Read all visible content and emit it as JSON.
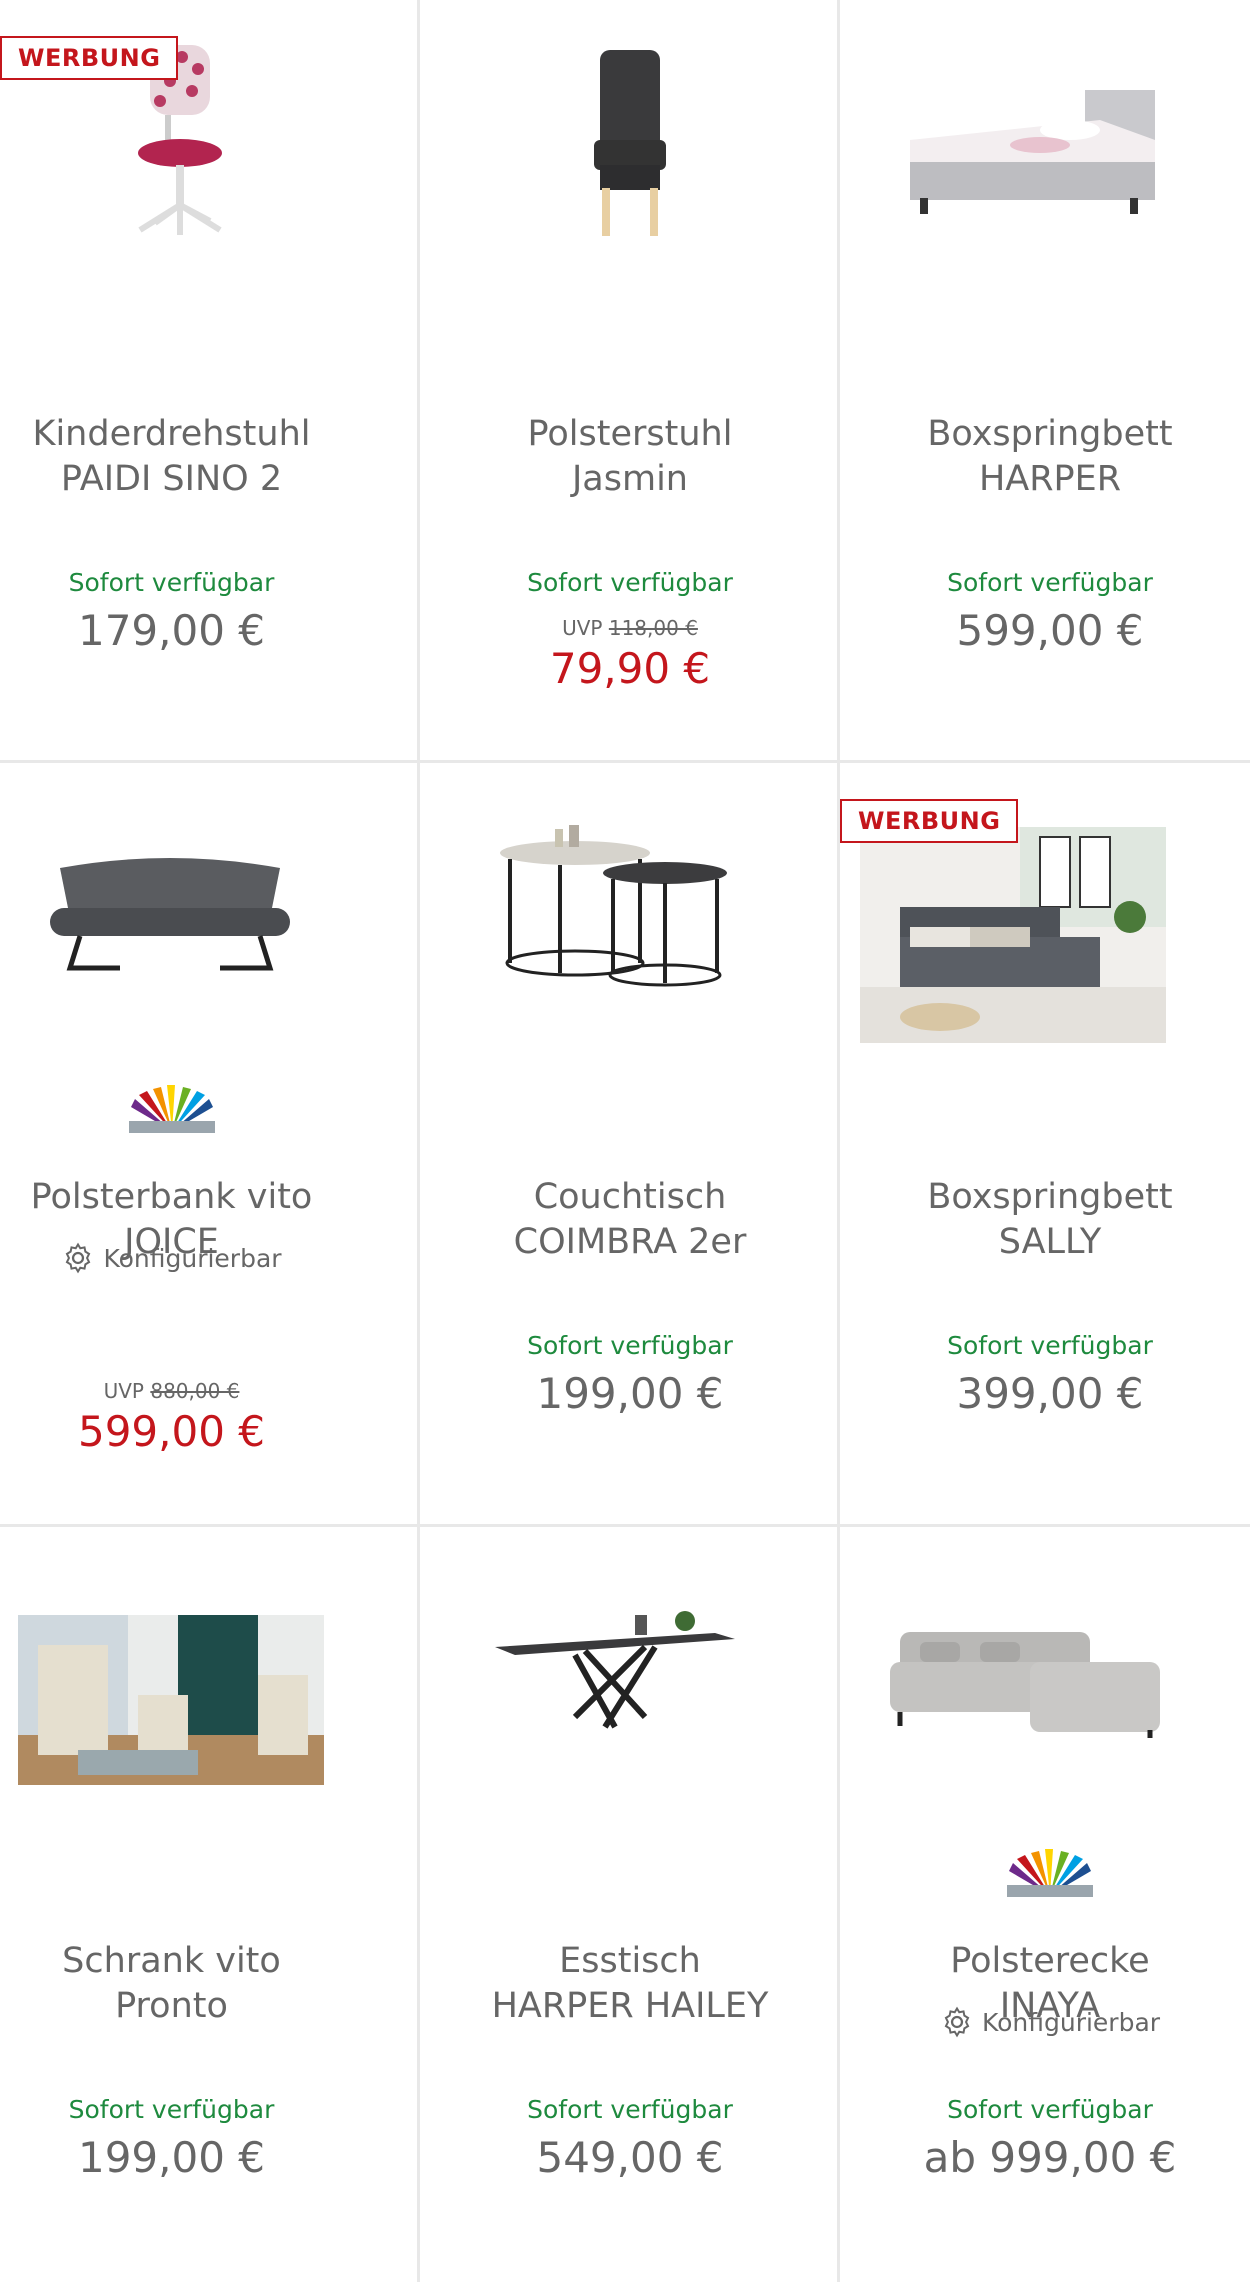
{
  "products": [
    {
      "badge": "WERBUNG",
      "title_line1": "Kinderdrehstuhl",
      "title_line2": "PAIDI SINO 2",
      "availability": "Sofort verfügbar",
      "price": "179,00 €",
      "image_icon": "child-swivel-chair-image"
    },
    {
      "title_line1": "Polsterstuhl",
      "title_line2": "Jasmin",
      "availability": "Sofort verfügbar",
      "uvp_label": "UVP",
      "uvp_price": "118,00 €",
      "price": "79,90 €",
      "image_icon": "upholstered-chair-image"
    },
    {
      "title_line1": "Boxspringbett",
      "title_line2": "HARPER",
      "availability": "Sofort verfügbar",
      "price": "599,00 €",
      "image_icon": "boxspring-bed-image"
    },
    {
      "title_line1": "Polsterbank vito",
      "title_line2": "JOICE",
      "configurable": "Konfigurierbar",
      "uvp_label": "UVP",
      "uvp_price": "880,00 €",
      "price": "599,00 €",
      "image_icon": "upholstered-bench-image",
      "has_palette": true
    },
    {
      "title_line1": "Couchtisch",
      "title_line2": "COIMBRA 2er",
      "availability": "Sofort verfügbar",
      "price": "199,00 €",
      "image_icon": "coffee-table-set-image"
    },
    {
      "badge": "WERBUNG",
      "title_line1": "Boxspringbett",
      "title_line2": "SALLY",
      "availability": "Sofort verfügbar",
      "price": "399,00 €",
      "image_icon": "bedroom-scene-image"
    },
    {
      "title_line1": "Schrank vito",
      "title_line2": "Pronto",
      "availability": "Sofort verfügbar",
      "price": "199,00 €",
      "image_icon": "office-room-scene-image"
    },
    {
      "title_line1": "Esstisch",
      "title_line2": "HARPER HAILEY",
      "availability": "Sofort verfügbar",
      "price": "549,00 €",
      "image_icon": "dining-table-image"
    },
    {
      "title_line1": "Polsterecke",
      "title_line2": "INAYA",
      "configurable": "Konfigurierbar",
      "availability": "Sofort verfügbar",
      "price": "ab 999,00 €",
      "image_icon": "corner-sofa-image",
      "has_palette": true
    }
  ],
  "colors": {
    "sale": "#c4161c",
    "available": "#1e8a3e",
    "text": "#666666",
    "grid": "#e8e8e8"
  }
}
